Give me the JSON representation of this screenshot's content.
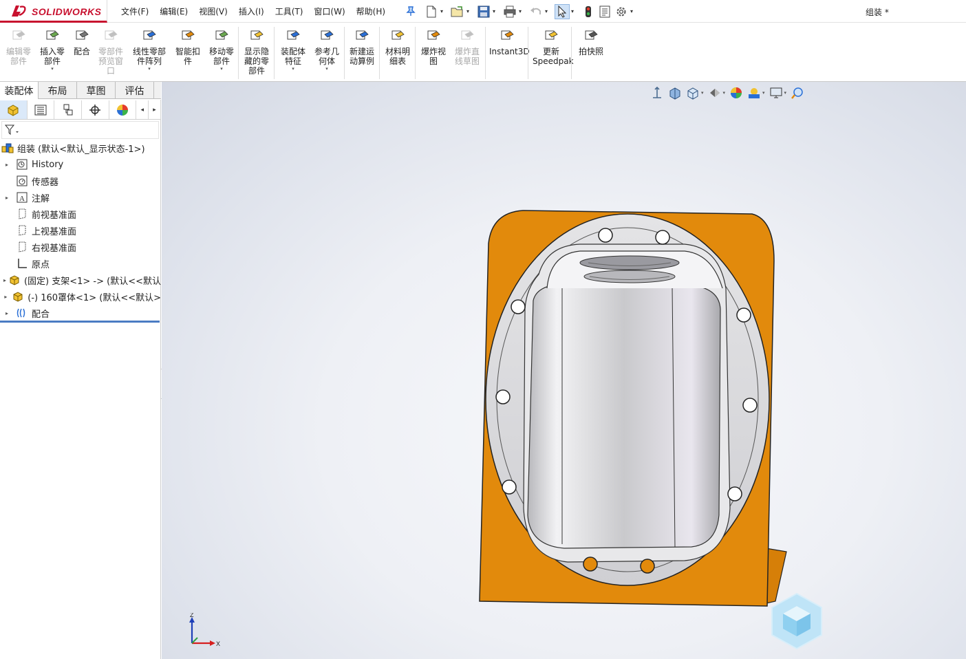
{
  "app": {
    "brand_ds": "3S",
    "brand_name": "SOLIDWORKS",
    "document_title": "组装 *"
  },
  "menu": [
    "文件(F)",
    "编辑(E)",
    "视图(V)",
    "插入(I)",
    "工具(T)",
    "窗口(W)",
    "帮助(H)"
  ],
  "quick_access": [
    {
      "name": "new-document",
      "icon": "new-file-icon"
    },
    {
      "name": "open-document",
      "icon": "open-folder-icon"
    },
    {
      "name": "save",
      "icon": "save-icon"
    },
    {
      "name": "print",
      "icon": "print-icon"
    },
    {
      "name": "undo",
      "icon": "undo-icon"
    },
    {
      "name": "select",
      "icon": "select-cursor-icon"
    },
    {
      "name": "rebuild",
      "icon": "traffic-light-icon"
    },
    {
      "name": "file-properties",
      "icon": "file-properties-icon"
    },
    {
      "name": "options",
      "icon": "gear-icon"
    }
  ],
  "commands": [
    {
      "label": "编辑零\n部件",
      "disabled": true,
      "dropdown": false
    },
    {
      "label": "插入零\n部件",
      "disabled": false,
      "dropdown": true
    },
    {
      "label": "配合",
      "disabled": false,
      "dropdown": false
    },
    {
      "label": "零部件\n预览窗\n口",
      "disabled": true,
      "dropdown": false
    },
    {
      "label": "线性零部\n件阵列",
      "disabled": false,
      "dropdown": true
    },
    {
      "label": "智能扣\n件",
      "disabled": false,
      "dropdown": false
    },
    {
      "label": "移动零\n部件",
      "disabled": false,
      "dropdown": true
    },
    {
      "label": "显示隐\n藏的零\n部件",
      "disabled": false,
      "dropdown": false
    },
    {
      "label": "装配体\n特征",
      "disabled": false,
      "dropdown": true
    },
    {
      "label": "参考几\n何体",
      "disabled": false,
      "dropdown": true
    },
    {
      "label": "新建运\n动算例",
      "disabled": false,
      "dropdown": false
    },
    {
      "label": "材料明\n细表",
      "disabled": false,
      "dropdown": false
    },
    {
      "label": "爆炸视\n图",
      "disabled": false,
      "dropdown": false
    },
    {
      "label": "爆炸直\n线草图",
      "disabled": true,
      "dropdown": false
    },
    {
      "label": "Instant3D",
      "disabled": false,
      "dropdown": false
    },
    {
      "label": "更新\nSpeedpak",
      "disabled": false,
      "dropdown": false
    },
    {
      "label": "拍快照",
      "disabled": false,
      "dropdown": false
    }
  ],
  "tabs": [
    {
      "label": "装配体",
      "active": true
    },
    {
      "label": "布局",
      "active": false
    },
    {
      "label": "草图",
      "active": false
    },
    {
      "label": "评估",
      "active": false
    }
  ],
  "panel_tabs": [
    "featuremanager",
    "propertymanager",
    "configurationmanager",
    "dimxpertmanager",
    "displaymanager"
  ],
  "tree": [
    {
      "label": "组装 (默认<默认_显示状态-1>)",
      "icon": "assembly-icon",
      "expander": false,
      "indent": 0
    },
    {
      "label": "History",
      "icon": "history-icon",
      "expander": true,
      "indent": 1
    },
    {
      "label": "传感器",
      "icon": "sensor-icon",
      "expander": false,
      "indent": 1
    },
    {
      "label": "注解",
      "icon": "annotation-icon",
      "expander": true,
      "indent": 1
    },
    {
      "label": "前视基准面",
      "icon": "plane-icon",
      "expander": false,
      "indent": 1
    },
    {
      "label": "上视基准面",
      "icon": "plane-icon",
      "expander": false,
      "indent": 1
    },
    {
      "label": "右视基准面",
      "icon": "plane-icon",
      "expander": false,
      "indent": 1
    },
    {
      "label": "原点",
      "icon": "origin-icon",
      "expander": false,
      "indent": 1
    },
    {
      "label": "(固定) 支架<1> -> (默认<<默认",
      "icon": "part-icon",
      "expander": true,
      "indent": 1
    },
    {
      "label": "(-) 160罩体<1> (默认<<默认>",
      "icon": "part-icon",
      "expander": true,
      "indent": 1
    },
    {
      "label": "配合",
      "icon": "mates-icon",
      "expander": true,
      "indent": 1
    }
  ],
  "triad": {
    "z": "Z",
    "x": "X"
  },
  "colors": {
    "bracket_orange": "#e28a0c",
    "housing_silver": "#d8d8dc",
    "accent_blue": "#2a6fd6",
    "brand_red": "#c8102e"
  }
}
